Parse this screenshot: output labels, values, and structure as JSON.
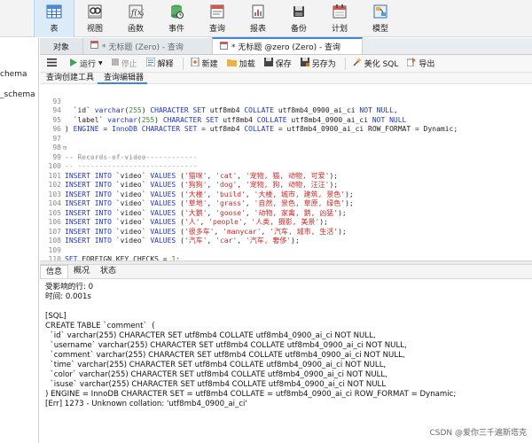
{
  "toolbar": {
    "buttons": [
      {
        "label": "表",
        "icon": "table-icon",
        "active": true
      },
      {
        "label": "视图",
        "icon": "view-icon"
      },
      {
        "label": "函数",
        "icon": "function-icon"
      },
      {
        "label": "事件",
        "icon": "event-icon"
      },
      {
        "label": "查询",
        "icon": "query-icon"
      },
      {
        "label": "报表",
        "icon": "report-icon"
      },
      {
        "label": "备份",
        "icon": "backup-icon"
      },
      {
        "label": "计划",
        "icon": "schedule-icon"
      },
      {
        "label": "模型",
        "icon": "model-icon"
      }
    ]
  },
  "left_panel": {
    "items": [
      "chema",
      "_schema"
    ]
  },
  "tabs": {
    "object": "对象",
    "tab1": "* 无标题 (Zero) - 查询",
    "tab2": "* 无标题 @zero (Zero) - 查询"
  },
  "editor_toolbar": {
    "menu_icon": "hamburger-icon",
    "run": "运行",
    "stop": "停止",
    "explain": "解释",
    "new": "新建",
    "load": "加载",
    "save": "保存",
    "save_as": "另存为",
    "beautify": "美化 SQL",
    "export": "导出"
  },
  "sub_tabs": [
    "查询创建工具",
    "查询编辑器"
  ],
  "code": {
    "line_numbers": [
      "93",
      "94",
      "95",
      "96",
      "97",
      "98",
      "99",
      "100",
      "101",
      "102",
      "103",
      "104",
      "105",
      "106",
      "107",
      "108",
      "109",
      "110"
    ],
    "lines": [
      "  `id` varchar(255) CHARACTER SET utf8mb4 COLLATE utf8mb4_0900_ai_ci NOT NULL,",
      "  `label` varchar(255) CHARACTER SET utf8mb4 COLLATE utf8mb4_0900_ai_ci NOT NULL",
      ") ENGINE = InnoDB CHARACTER SET = utf8mb4 COLLATE = utf8mb4_0900_ai_ci ROW_FORMAT = Dynamic;",
      "",
      "-- ----------------------------",
      "-- Records of video",
      "-- ----------------------------",
      "INSERT INTO `video` VALUES ('猫咪', 'cat', '宠物, 猫, 动物, 可爱');",
      "INSERT INTO `video` VALUES ('狗狗', 'dog', '宠物, 狗, 动物, 汪汪');",
      "INSERT INTO `video` VALUES ('大楼', 'build', '大楼, 城市, 建筑, 景色');",
      "INSERT INTO `video` VALUES ('草地', 'grass', '自然, 景色, 草原, 绿色');",
      "INSERT INTO `video` VALUES ('大鹅', 'goose', '动物, 家禽, 鹅, 凶猛');",
      "INSERT INTO `video` VALUES ('人', 'people', '人类, 摄影, 美景');",
      "INSERT INTO `video` VALUES ('很多车', 'manycar', '汽车, 城市, 生活');",
      "INSERT INTO `video` VALUES ('汽车', 'car', '汽车, 奢侈');",
      "",
      "SET FOREIGN_KEY_CHECKS = 1;",
      ""
    ]
  },
  "result_tabs": [
    "信息",
    "概况",
    "状态"
  ],
  "messages": [
    "受影响的行: 0",
    "时间: 0.001s",
    "",
    "[SQL]",
    "CREATE TABLE `comment`  (",
    "  `id` varchar(255) CHARACTER SET utf8mb4 COLLATE utf8mb4_0900_ai_ci NOT NULL,",
    "  `username` varchar(255) CHARACTER SET utf8mb4 COLLATE utf8mb4_0900_ai_ci NOT NULL,",
    "  `comment` varchar(255) CHARACTER SET utf8mb4 COLLATE utf8mb4_0900_ai_ci NOT NULL,",
    "  `time` varchar(255) CHARACTER SET utf8mb4 COLLATE utf8mb4_0900_ai_ci NOT NULL,",
    "  `color` varchar(255) CHARACTER SET utf8mb4 COLLATE utf8mb4_0900_ai_ci NOT NULL,",
    "  `isuse` varchar(255) CHARACTER SET utf8mb4 COLLATE utf8mb4_0900_ai_ci NOT NULL",
    ") ENGINE = InnoDB CHARACTER SET = utf8mb4 COLLATE = utf8mb4_0900_ai_ci ROW_FORMAT = Dynamic;",
    "[Err] 1273 - Unknown collation: 'utf8mb4_0900_ai_ci'"
  ],
  "watermark": "CSDN @爱你三千遍斯塔克",
  "colors": {
    "keyword": "#1f35c6",
    "string": "#c72a2a",
    "comment": "#9a9a9a",
    "number": "#3a8a3a",
    "accent": "#3b8ad9"
  }
}
